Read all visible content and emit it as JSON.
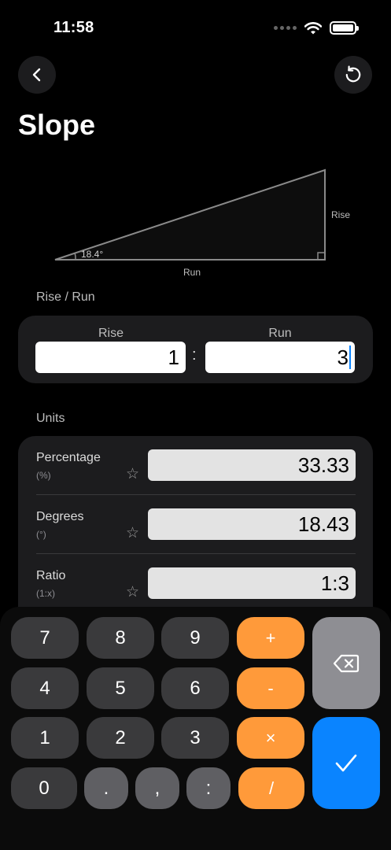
{
  "status": {
    "time": "11:58"
  },
  "header": {
    "title": "Slope"
  },
  "diagram": {
    "angle_label": "18.4°",
    "run_label": "Run",
    "rise_label": "Rise"
  },
  "rise_run": {
    "section_label": "Rise / Run",
    "rise_header": "Rise",
    "run_header": "Run",
    "rise_value": "1",
    "run_value": "3",
    "separator": ":"
  },
  "units": {
    "section_label": "Units",
    "rows": [
      {
        "name": "Percentage",
        "unit": "(%)",
        "value": "33.33"
      },
      {
        "name": "Degrees",
        "unit": "(°)",
        "value": "18.43"
      },
      {
        "name": "Ratio",
        "unit": "(1:x)",
        "value": "1:3"
      }
    ]
  },
  "keypad": {
    "k7": "7",
    "k8": "8",
    "k9": "9",
    "plus": "+",
    "k4": "4",
    "k5": "5",
    "k6": "6",
    "minus": "-",
    "k1": "1",
    "k2": "2",
    "k3": "3",
    "times": "×",
    "k0": "0",
    "dot": ".",
    "comma": ",",
    "colon": ":",
    "slash": "/"
  },
  "icons": {
    "back": "chevron-left-icon",
    "reset": "counterclockwise-arrow-icon",
    "delete": "backspace-icon",
    "confirm": "checkmark-icon",
    "star": "star-outline-icon"
  },
  "colors": {
    "accent_orange": "#ff9a3a",
    "accent_blue": "#0a84ff",
    "background": "#000000",
    "card": "#1c1c1e"
  }
}
